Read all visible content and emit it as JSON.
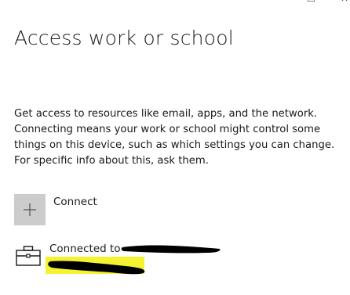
{
  "window": {
    "maximize_icon": "maximize-icon",
    "close_icon": "close-icon"
  },
  "page": {
    "title": "Access work or school",
    "description": "Get access to resources like email, apps, and the network. Connecting means your work or school might control some things on this device, such as which settings you can change. For specific info about this, ask them."
  },
  "connect": {
    "label": "Connect",
    "icon": "plus-icon",
    "tile_color": "#cccccc"
  },
  "account": {
    "icon": "briefcase-icon",
    "label_prefix": "Connected to",
    "highlight_color": "#f5f232"
  }
}
